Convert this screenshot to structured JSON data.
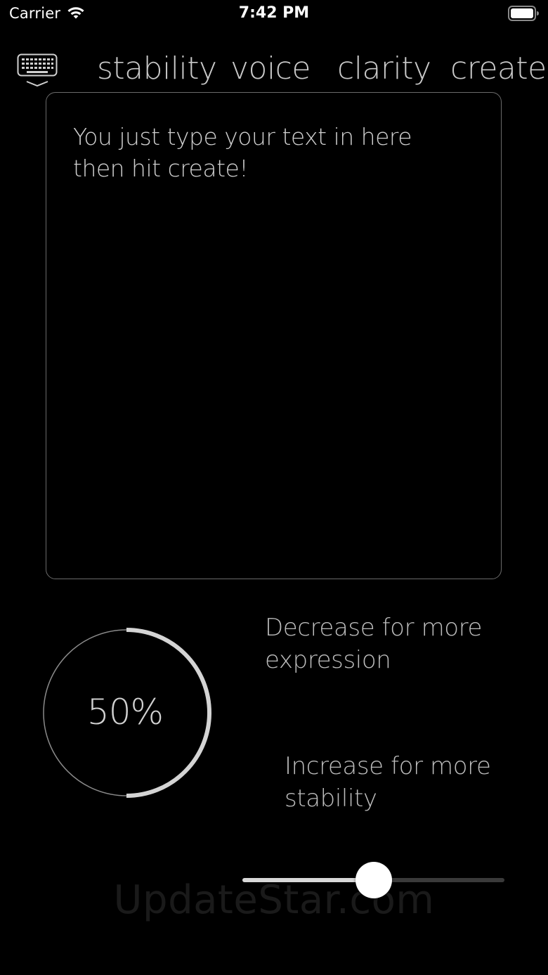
{
  "status_bar": {
    "carrier": "Carrier",
    "time": "7:42 PM",
    "wifi_icon": "wifi-icon",
    "battery_icon": "battery-full-icon"
  },
  "toolbar": {
    "keyboard_icon": "keyboard-dismiss-icon",
    "tabs": [
      {
        "label": "stability"
      },
      {
        "label": "voice"
      },
      {
        "label": "clarity"
      },
      {
        "label": "create"
      }
    ]
  },
  "editor": {
    "text": "You just type your text in here then hit create!"
  },
  "stability": {
    "value_label": "50%",
    "value_fraction": 0.5,
    "hint_decrease": "Decrease for more expression",
    "hint_increase": "Increase for more stability",
    "slider_value": 0.5
  },
  "watermark": "UpdateStar.com",
  "colors": {
    "background": "#000000",
    "text": "#c9c9c9",
    "border": "#6b6b6b",
    "accent": "#d8d8d8"
  }
}
